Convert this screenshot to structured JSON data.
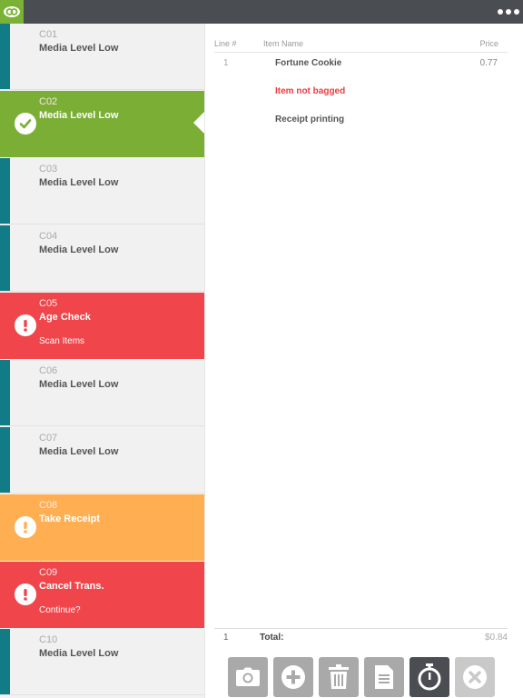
{
  "app": {
    "logo_icon": "link-logo-icon",
    "menu_icon": "more-dots-icon",
    "accent": "#7ab235"
  },
  "lanes": [
    {
      "code": "C01",
      "title": "Media Level Low",
      "sub": "",
      "state": "normal"
    },
    {
      "code": "C02",
      "title": "Media Level Low",
      "sub": "",
      "state": "selected",
      "icon": "check-circle-icon"
    },
    {
      "code": "C03",
      "title": "Media Level Low",
      "sub": "",
      "state": "normal"
    },
    {
      "code": "C04",
      "title": "Media Level Low",
      "sub": "",
      "state": "normal"
    },
    {
      "code": "C05",
      "title": "Age Check",
      "sub": "Scan Items",
      "state": "alert",
      "icon": "exclamation-circle-icon"
    },
    {
      "code": "C06",
      "title": "Media Level Low",
      "sub": "",
      "state": "normal"
    },
    {
      "code": "C07",
      "title": "Media Level Low",
      "sub": "",
      "state": "normal"
    },
    {
      "code": "C08",
      "title": "Take Receipt",
      "sub": "",
      "state": "warning",
      "icon": "exclamation-circle-icon"
    },
    {
      "code": "C09",
      "title": "Cancel Trans.",
      "sub": "Continue?",
      "state": "alert",
      "icon": "exclamation-circle-icon"
    },
    {
      "code": "C10",
      "title": "Media Level Low",
      "sub": "",
      "state": "normal"
    }
  ],
  "receipt": {
    "headers": {
      "line": "Line #",
      "item": "Item Name",
      "price": "Price"
    },
    "rows": [
      {
        "line": "1",
        "name": "Fortune Cookie",
        "price": "0.77",
        "alert": false
      },
      {
        "line": "",
        "name": "Item not bagged",
        "price": "",
        "alert": true
      },
      {
        "line": "",
        "name": "Receipt printing",
        "price": "",
        "alert": false
      }
    ],
    "total": {
      "count": "1",
      "label": "Total:",
      "value": "$0.84"
    }
  },
  "toolbar": [
    {
      "name": "camera-button",
      "icon": "camera-icon",
      "state": "normal"
    },
    {
      "name": "add-button",
      "icon": "plus-circle-icon",
      "state": "normal"
    },
    {
      "name": "delete-button",
      "icon": "trash-icon",
      "state": "normal"
    },
    {
      "name": "document-button",
      "icon": "document-icon",
      "state": "normal"
    },
    {
      "name": "timer-button",
      "icon": "stopwatch-icon",
      "state": "active"
    },
    {
      "name": "cancel-button",
      "icon": "close-circle-icon",
      "state": "disabled"
    }
  ],
  "colors": {
    "selected": "#7aae35",
    "alert": "#f0454a",
    "warning": "#ffaf52",
    "lane_stripe": "#117c86",
    "alert_text": "#ee3b41"
  }
}
